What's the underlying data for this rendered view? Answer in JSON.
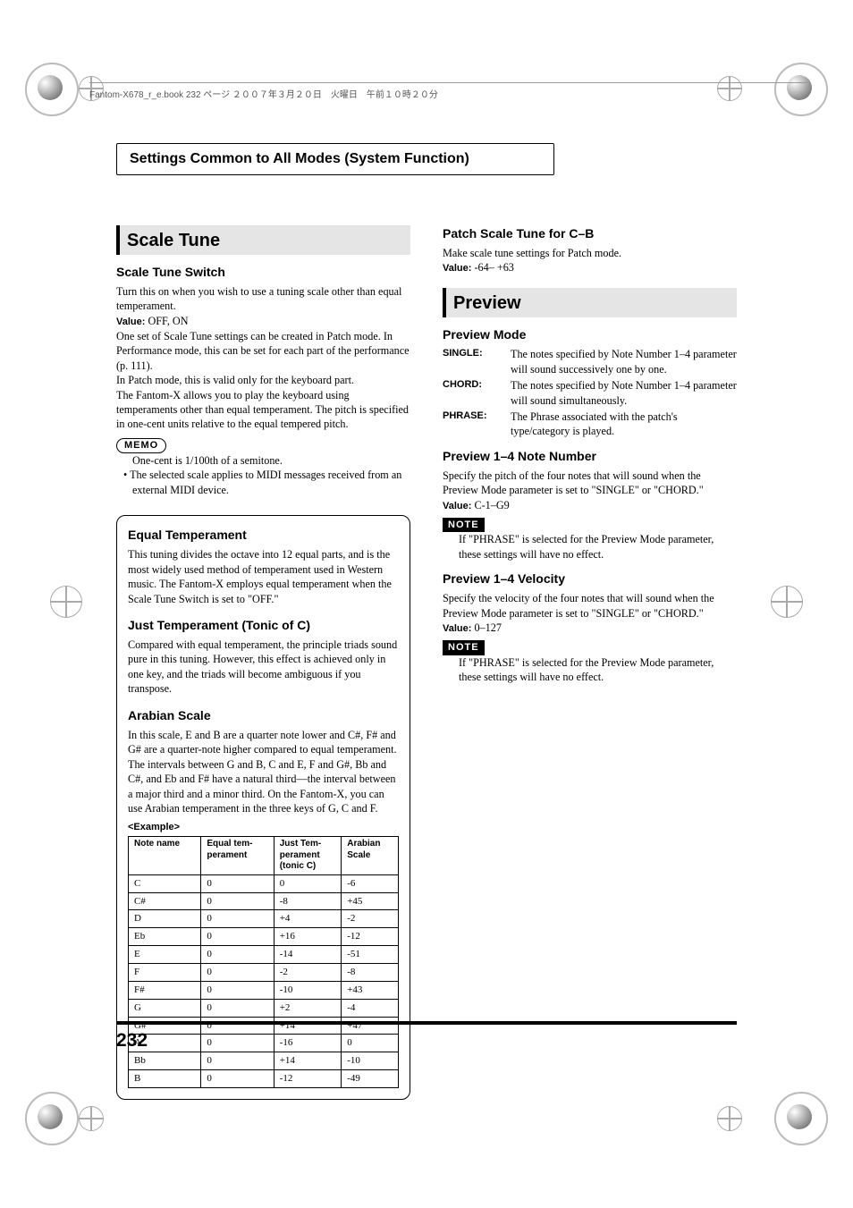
{
  "print_header": {
    "text": "Fantom-X678_r_e.book 232 ページ ２００７年３月２０日　火曜日　午前１０時２０分"
  },
  "page_header": {
    "title": "Settings Common to All Modes (System Function)"
  },
  "page_number": "232",
  "scale_tune": {
    "title": "Scale Tune",
    "switch": {
      "heading": "Scale Tune Switch",
      "body1": "Turn this on when you wish to use a tuning scale other than equal temperament.",
      "value_label": "Value:",
      "value": "OFF, ON",
      "body2": "One set of Scale Tune settings can be created in Patch mode. In Performance mode, this can be set for each part of the performance (p. 111).",
      "body3": "In Patch mode, this is valid only for the keyboard part.",
      "body4": "The Fantom-X allows you to play the keyboard using temperaments other than equal temperament. The pitch is specified in one-cent units relative to the equal tempered pitch."
    },
    "memo": {
      "label": "MEMO",
      "line1": "One-cent is 1/100th of a semitone.",
      "line2": "•  The selected scale applies to MIDI messages received from an external MIDI device."
    },
    "equal": {
      "heading": "Equal Temperament",
      "body": "This tuning divides the octave into 12 equal parts, and is the most widely used method of temperament used in Western music. The Fantom-X employs equal temperament when the Scale Tune Switch is set to \"OFF.\""
    },
    "just": {
      "heading": "Just Temperament (Tonic of C)",
      "body": "Compared with equal temperament, the principle triads sound pure in this tuning. However, this effect is achieved only in one key, and the triads will become ambiguous if you transpose."
    },
    "arabian": {
      "heading": "Arabian Scale",
      "body": "In this scale, E and B are a quarter note lower and C#, F# and G# are a quarter-note higher compared to equal temperament. The intervals between G and B, C and E, F and G#, Bb and C#, and Eb and F# have a natural third—the interval between a major third and a minor third. On the Fantom-X, you can use Arabian temperament in the three keys of G, C and F."
    },
    "example_label": "<Example>",
    "table": {
      "headers": [
        "Note name",
        "Equal tem-\nperament",
        "Just Tem-\nperament\n(tonic C)",
        "Arabian\nScale"
      ],
      "rows": [
        [
          "C",
          "0",
          "0",
          "-6"
        ],
        [
          "C#",
          "0",
          "-8",
          "+45"
        ],
        [
          "D",
          "0",
          "+4",
          "-2"
        ],
        [
          "Eb",
          "0",
          "+16",
          "-12"
        ],
        [
          "E",
          "0",
          "-14",
          "-51"
        ],
        [
          "F",
          "0",
          "-2",
          "-8"
        ],
        [
          "F#",
          "0",
          "-10",
          "+43"
        ],
        [
          "G",
          "0",
          "+2",
          "-4"
        ],
        [
          "G#",
          "0",
          "+14",
          "+47"
        ],
        [
          "A",
          "0",
          "-16",
          "0"
        ],
        [
          "Bb",
          "0",
          "+14",
          "-10"
        ],
        [
          "B",
          "0",
          "-12",
          "-49"
        ]
      ]
    }
  },
  "patch_scale": {
    "heading": "Patch Scale Tune for C–B",
    "body": "Make scale tune settings for Patch mode.",
    "value_label": "Value:",
    "value": "-64– +63"
  },
  "preview": {
    "title": "Preview",
    "mode": {
      "heading": "Preview Mode",
      "rows": [
        {
          "k": "SINGLE:",
          "v": "The notes specified by Note Number 1–4 parameter will sound successively one by one."
        },
        {
          "k": "CHORD:",
          "v": "The notes specified by Note Number 1–4 parameter will sound simultaneously."
        },
        {
          "k": "PHRASE:",
          "v": "The Phrase associated with the patch's type/category is played."
        }
      ]
    },
    "note_number": {
      "heading": "Preview 1–4 Note Number",
      "body": "Specify the pitch of the four notes that will sound when the Preview Mode parameter is set to \"SINGLE\" or \"CHORD.\"",
      "value_label": "Value:",
      "value": "C-1–G9",
      "note_label": "NOTE",
      "note_body": "If \"PHRASE\" is selected for the Preview Mode parameter, these settings will have no effect."
    },
    "velocity": {
      "heading": "Preview 1–4 Velocity",
      "body": "Specify the velocity of the four notes that will sound when the Preview Mode parameter is set to \"SINGLE\" or \"CHORD.\"",
      "value_label": "Value:",
      "value": "0–127",
      "note_label": "NOTE",
      "note_body": "If \"PHRASE\" is selected for the Preview Mode parameter, these settings will have no effect."
    }
  }
}
